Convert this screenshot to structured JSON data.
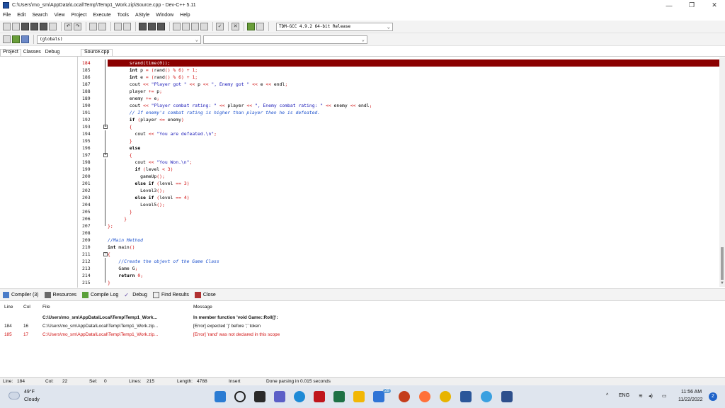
{
  "window": {
    "title": "C:\\Users\\mo_sm\\AppData\\Local\\Temp\\Temp1_Work.zip\\Source.cpp - Dev-C++ 5.11",
    "controls": {
      "minimize": "—",
      "maximize": "❐",
      "close": "✕"
    }
  },
  "menu": [
    "File",
    "Edit",
    "Search",
    "View",
    "Project",
    "Execute",
    "Tools",
    "AStyle",
    "Window",
    "Help"
  ],
  "toolbar": {
    "compiler": "TDM-GCC 4.9.2 64-bit Release",
    "globals": "(globals)",
    "second_select": ""
  },
  "left_tabs": [
    "Project",
    "Classes",
    "Debug"
  ],
  "editor_tab": "Source.cpp",
  "code": {
    "highlight_color": "#8b0000",
    "lines": [
      {
        "n": "184",
        "text": "srand(time(0));"
      },
      {
        "n": "185",
        "text": "int p = (rand() % 6) + 1;"
      },
      {
        "n": "186",
        "text": "int e = (rand() % 6) + 1;"
      },
      {
        "n": "187",
        "text": "cout << \"Player got \" << p << \", Enemy got \" << e << endl;"
      },
      {
        "n": "188",
        "text": "player += p;"
      },
      {
        "n": "189",
        "text": "enemy += e;"
      },
      {
        "n": "190",
        "text": "cout << \"Player combat rating: \" << player << \", Enemy combat rating: \" << enemy << endl;"
      },
      {
        "n": "191",
        "text": "// If enemy's combat rating is higher than player then he is defeated."
      },
      {
        "n": "192",
        "text": "if (player <= enemy)"
      },
      {
        "n": "193",
        "text": "{"
      },
      {
        "n": "194",
        "text": "cout << \"You are defeated.\\n\";"
      },
      {
        "n": "195",
        "text": "}"
      },
      {
        "n": "196",
        "text": "else"
      },
      {
        "n": "197",
        "text": "{"
      },
      {
        "n": "198",
        "text": "cout << \"You Won.\\n\";"
      },
      {
        "n": "199",
        "text": "if (level < 3)"
      },
      {
        "n": "200",
        "text": "gameUp();"
      },
      {
        "n": "201",
        "text": "else if (level == 3)"
      },
      {
        "n": "202",
        "text": "Level3();"
      },
      {
        "n": "203",
        "text": "else if (level == 4)"
      },
      {
        "n": "204",
        "text": "Level5();"
      },
      {
        "n": "205",
        "text": "}"
      },
      {
        "n": "206",
        "text": "}"
      },
      {
        "n": "207",
        "text": "};"
      },
      {
        "n": "208",
        "text": ""
      },
      {
        "n": "209",
        "text": "//Main Method"
      },
      {
        "n": "210",
        "text": "int main()"
      },
      {
        "n": "211",
        "text": "{"
      },
      {
        "n": "212",
        "text": "//Create the objevt of the Game Class"
      },
      {
        "n": "213",
        "text": "Game G;"
      },
      {
        "n": "214",
        "text": "return 0;"
      },
      {
        "n": "215",
        "text": "}"
      }
    ]
  },
  "bottom_tabs": [
    "Compiler (3)",
    "Resources",
    "Compile Log",
    "Debug",
    "Find Results",
    "Close"
  ],
  "messages": {
    "headers": [
      "Line",
      "Col",
      "File",
      "Message"
    ],
    "rows": [
      {
        "line": "",
        "col": "",
        "file": "C:\\Users\\mo_sm\\AppData\\Local\\Temp\\Temp1_Work...",
        "message": "In member function 'void Game::Roll()':"
      },
      {
        "line": "184",
        "col": "16",
        "file": "C:\\Users\\mo_sm\\AppData\\Local\\Temp\\Temp1_Work.zip...",
        "message": "[Error] expected ')' before ';' token"
      },
      {
        "line": "185",
        "col": "17",
        "file": "C:\\Users\\mo_sm\\AppData\\Local\\Temp\\Temp1_Work.zip...",
        "message": "[Error] 'rand' was not declared in this scope"
      }
    ]
  },
  "status": {
    "line": "Line:",
    "line_val": "184",
    "col": "Col:",
    "col_val": "22",
    "sel": "Sel:",
    "sel_val": "0",
    "lines": "Lines:",
    "lines_val": "215",
    "length": "Length:",
    "length_val": "4788",
    "mode": "Insert",
    "message": "Done parsing in 0.015 seconds"
  },
  "taskbar": {
    "temp": "49°F",
    "weather": "Cloudy",
    "lang": "ENG",
    "time": "11:56 AM",
    "date": "11/22/2022",
    "notif_count": "2",
    "badge": "28"
  }
}
